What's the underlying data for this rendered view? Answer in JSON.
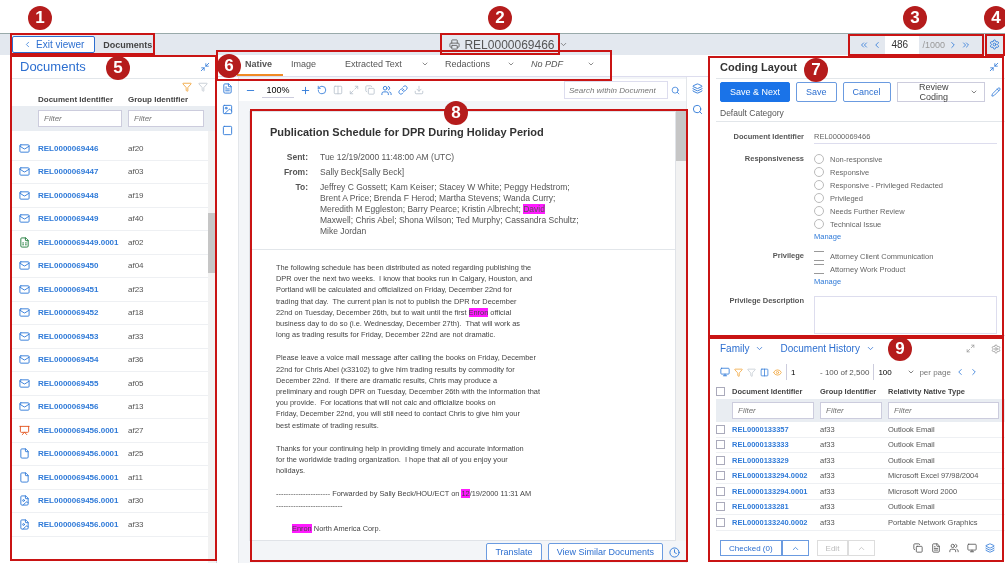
{
  "callouts": [
    {
      "label": "1"
    },
    {
      "label": "2"
    },
    {
      "label": "3"
    },
    {
      "label": "4"
    },
    {
      "label": "5"
    },
    {
      "label": "6"
    },
    {
      "label": "7"
    },
    {
      "label": "8"
    },
    {
      "label": "9"
    }
  ],
  "top_bar": {
    "exit_button": "Exit viewer",
    "breadcrumb": "Documents",
    "document": "REL0000069466",
    "page_input": "486",
    "page_total": "/1000"
  },
  "documents_panel": {
    "title": "Documents",
    "columns": [
      "Document Identifier",
      "Group Identifier"
    ],
    "filter_placeholders": [
      "Filter",
      "Filter"
    ],
    "rows": [
      {
        "kind": "email",
        "id": "REL0000069446",
        "group": "af20"
      },
      {
        "kind": "email",
        "id": "REL0000069447",
        "group": "af03"
      },
      {
        "kind": "email",
        "id": "REL0000069448",
        "group": "af19"
      },
      {
        "kind": "email",
        "id": "REL0000069449",
        "group": "af40"
      },
      {
        "kind": "spreadsheet",
        "id": "REL0000069449.0001",
        "group": "af02"
      },
      {
        "kind": "email",
        "id": "REL0000069450",
        "group": "af04"
      },
      {
        "kind": "email",
        "id": "REL0000069451",
        "group": "af23"
      },
      {
        "kind": "email",
        "id": "REL0000069452",
        "group": "af18"
      },
      {
        "kind": "email",
        "id": "REL0000069453",
        "group": "af33"
      },
      {
        "kind": "email",
        "id": "REL0000069454",
        "group": "af36"
      },
      {
        "kind": "email",
        "id": "REL0000069455",
        "group": "af05"
      },
      {
        "kind": "email",
        "id": "REL0000069456",
        "group": "af13"
      },
      {
        "kind": "presentation",
        "id": "REL0000069456.0001",
        "group": "af27"
      },
      {
        "kind": "file",
        "id": "REL0000069456.0001",
        "group": "af25"
      },
      {
        "kind": "file",
        "id": "REL0000069456.0001",
        "group": "af11"
      },
      {
        "kind": "image",
        "id": "REL0000069456.0001",
        "group": "af30"
      },
      {
        "kind": "image",
        "id": "REL0000069456.0001",
        "group": "af33"
      }
    ]
  },
  "viewer": {
    "tabs": [
      {
        "label": "Native",
        "selected": true,
        "has_menu": false
      },
      {
        "label": "Image",
        "selected": false,
        "has_menu": false
      },
      {
        "label": "Extracted Text",
        "selected": false,
        "has_menu": true
      },
      {
        "label": "Redactions",
        "selected": false,
        "has_menu": true
      },
      {
        "label": "No PDF",
        "selected": false,
        "has_menu": true
      }
    ],
    "zoom": "100%",
    "search_placeholder": "Search within Document",
    "document": {
      "title": "Publication Schedule for DPR During Holiday Period",
      "headers": [
        {
          "label": "Sent:",
          "lines": [
            "Tue 12/19/2000 11:48:00 AM (UTC)"
          ]
        },
        {
          "label": "From:",
          "lines": [
            "Sally Beck[Sally Beck]"
          ]
        },
        {
          "label": "To:",
          "lines": [
            "Jeffrey C Gossett; Kam Keiser; Stacey W White; Peggy Hedstrom;",
            "Brent A Price; Brenda F Herod; Martha Stevens; Wanda Curry;",
            {
              "parts": [
                {
                  "text": "Meredith M Eggleston; Barry Pearce; Kristin Albrecht; ",
                  "highlight": false
                },
                {
                  "text": "David",
                  "highlight": true
                }
              ]
            },
            "Maxwell; Chris Abel; Shona Wilson; Ted Murphy; Cassandra Schultz;",
            "Mike Jordan"
          ]
        }
      ],
      "body": [
        {
          "indent": false,
          "lines": [
            "The following schedule has been distributed as noted regarding publishing the",
            "DPR over the next two weeks.  I know that books run in Calgary, Houston, and",
            "Portland will be calculated and officialized on Friday, December 22nd for",
            "trading that day.  The current plan is not to publish the DPR for December",
            {
              "parts": [
                {
                  "text": "22nd on Tuesday, December 26th, but to wait until the first ",
                  "highlight": false
                },
                {
                  "text": "Enron",
                  "highlight": true
                },
                {
                  "text": " official",
                  "highlight": false
                }
              ]
            },
            "business day to do so (i.e. Wednesday, December 27th).  That will work as",
            "long as trading results for Friday, December 22nd are not dramatic."
          ]
        },
        {
          "indent": false,
          "lines": [
            "Please leave a voice mail message after calling the books on Friday, December",
            "22nd for Chris Abel (x33102) to give him trading results by commodity for",
            "December 22nd.  If there are dramatic results, Chris may produce a",
            "preliminary and rough DPR on Tuesday, December 26th with the information that",
            "you provide.  For locations that will not calc and officialize books on",
            "Friday, December 22nd, you will still need to contact Chris to give him your",
            "best estimate of trading results."
          ]
        },
        {
          "indent": false,
          "lines": [
            "Thanks for your continuing help in providing timely and accurate information",
            "for the worldwide trading organization.  I hope that all of you enjoy your",
            "holidays."
          ]
        },
        {
          "indent": false,
          "lines": [
            {
              "parts": [
                {
                  "text": "---------------------- Forwarded by Sally Beck/HOU/ECT on ",
                  "highlight": false
                },
                {
                  "text": "12",
                  "highlight": true
                },
                {
                  "text": "/19/2000 11:31 AM",
                  "highlight": false
                }
              ]
            },
            "---------------------------"
          ]
        },
        {
          "indent": true,
          "lines": [
            {
              "parts": [
                {
                  "text": "Enron",
                  "highlight": true
                },
                {
                  "text": " North America Corp.",
                  "highlight": false
                }
              ]
            }
          ]
        }
      ]
    },
    "buttons": [
      "Translate",
      "View Similar Documents"
    ]
  },
  "coding": {
    "title": "Coding Layout",
    "buttons": [
      {
        "label": "Save & Next",
        "kind": "primary"
      },
      {
        "label": "Save",
        "kind": "outline"
      },
      {
        "label": "Cancel",
        "kind": "outline"
      }
    ],
    "layout_select": "Review Coding",
    "category": "Default Category",
    "fields": [
      {
        "kind": "text",
        "label": "Document Identifier",
        "value": "REL0000069466"
      },
      {
        "kind": "radio",
        "label": "Responsiveness",
        "options": [
          {
            "label": "Non-responsive",
            "selected": false
          },
          {
            "label": "Responsive",
            "selected": false
          },
          {
            "label": "Responsive - Privileged Redacted",
            "selected": false
          },
          {
            "label": "Privileged",
            "selected": false
          },
          {
            "label": "Needs Further Review",
            "selected": false
          },
          {
            "label": "Technical Issue",
            "selected": false
          }
        ],
        "link": "Manage"
      },
      {
        "kind": "checkbox",
        "label": "Privilege",
        "options": [
          {
            "label": "Attorney Client Communication",
            "checked": false
          },
          {
            "label": "Attorney Work Product",
            "checked": false
          }
        ],
        "link": "Manage"
      },
      {
        "kind": "textarea",
        "label": "Privilege Description"
      }
    ]
  },
  "related": {
    "all_checked": false,
    "tabs": [
      "Family",
      "Document History"
    ],
    "page": "1",
    "range": "- 100 of 2,500",
    "per_page": "100",
    "per_page_label": "per page",
    "columns": [
      "Document Identifier",
      "Group Identifier",
      "Relativity Native Type"
    ],
    "filter_placeholders": [
      "Filter",
      "Filter",
      "Filter"
    ],
    "rows": [
      {
        "id": "REL0000133357",
        "group": "af33",
        "type": "Outlook Email",
        "checked": false
      },
      {
        "id": "REL0000133333",
        "group": "af33",
        "type": "Outlook Email",
        "checked": false
      },
      {
        "id": "REL0000133329",
        "group": "af33",
        "type": "Outlook Email",
        "checked": false
      },
      {
        "id": "REL0000133294.0002",
        "group": "af33",
        "type": "Microsoft Excel 97/98/2004",
        "checked": false
      },
      {
        "id": "REL0000133294.0001",
        "group": "af33",
        "type": "Microsoft Word 2000",
        "checked": false
      },
      {
        "id": "REL0000133281",
        "group": "af33",
        "type": "Outlook Email",
        "checked": false
      },
      {
        "id": "REL0000133240.0002",
        "group": "af33",
        "type": "Portable Network Graphics",
        "checked": false
      }
    ],
    "checked_button": "Checked (0)",
    "edit_button": "Edit"
  }
}
